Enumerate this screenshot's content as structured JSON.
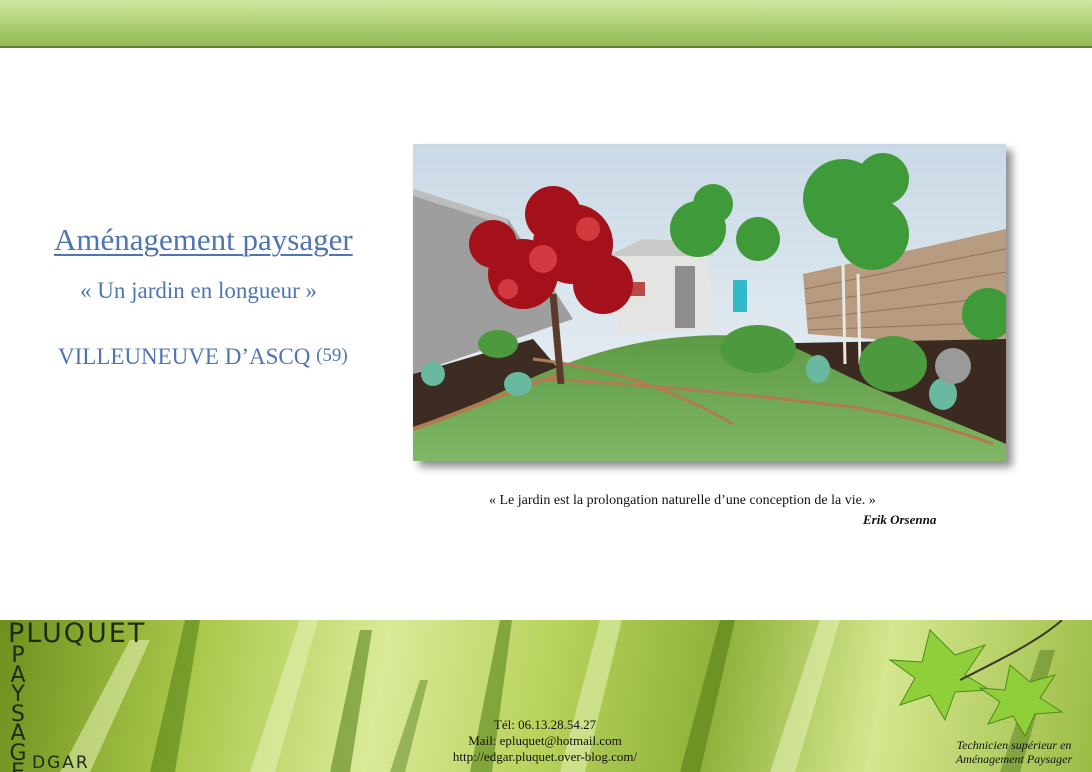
{
  "header": {
    "title": "Aménagement paysager",
    "subtitle": "« Un jardin en longueur »",
    "location": "VILLEUNEUVE D’ASCQ",
    "department": "(59)"
  },
  "image": {
    "subject": "garden-3d-render-icon"
  },
  "quote": {
    "text": "« Le jardin est la prolongation naturelle d’une conception de la vie. »",
    "author": "Erik Orsenna"
  },
  "footer": {
    "brand": {
      "top": "PLUQUET",
      "vertical": [
        "P",
        "A",
        "Y",
        "S",
        "A",
        "G",
        "E"
      ],
      "bottom": "DGAR"
    },
    "contact": {
      "phone": "Tél: 06.13.28.54.27",
      "mail": "Mail: epluquet@hotmail.com",
      "url": "http://edgar.pluquet.over-blog.com/"
    },
    "tagline": {
      "line1": "Technicien supérieur en",
      "line2": "Aménagement Paysager"
    }
  }
}
